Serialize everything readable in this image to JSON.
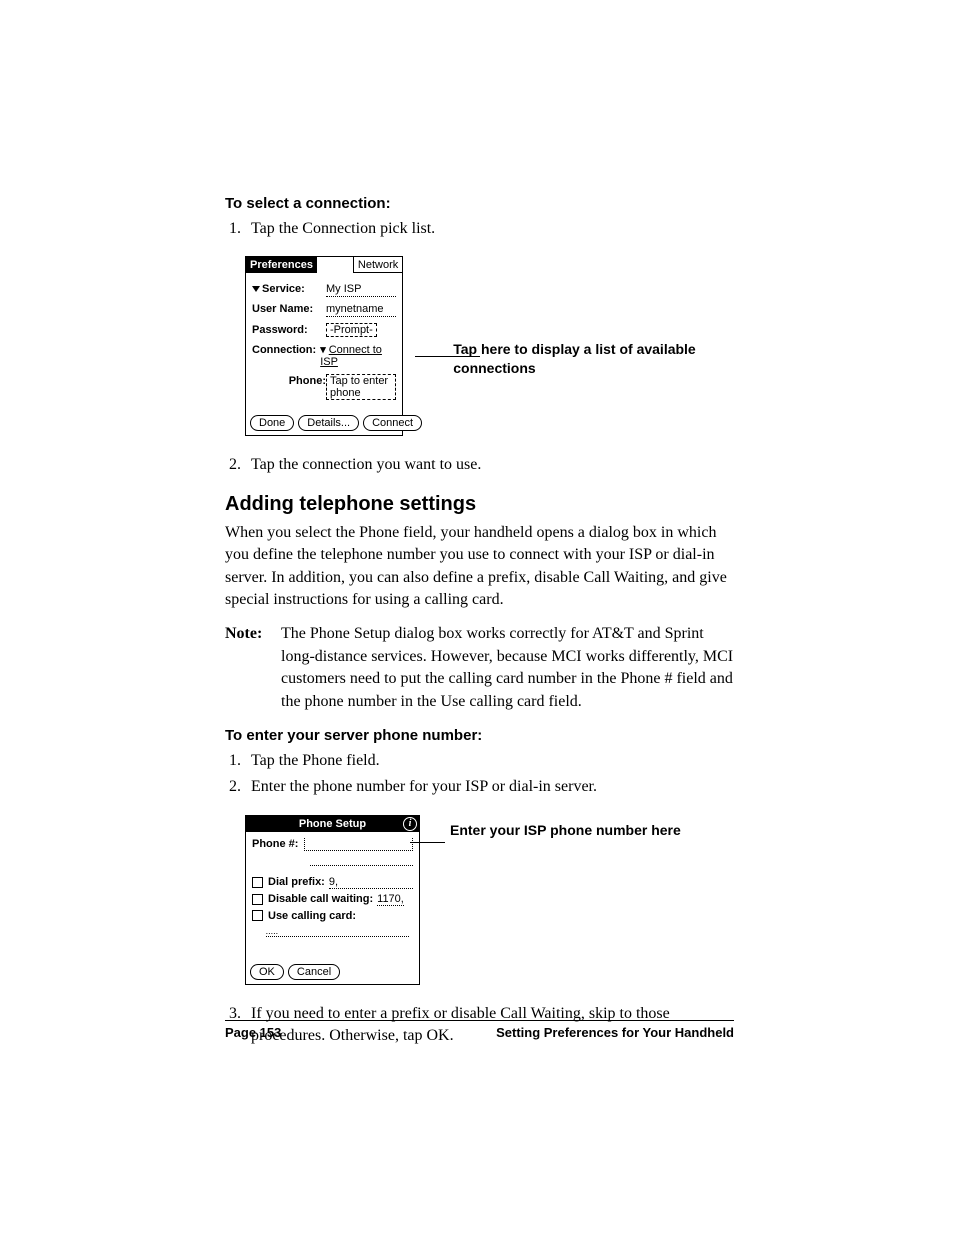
{
  "headings": {
    "select_connection": "To select a connection:",
    "adding_telephone": "Adding telephone settings",
    "enter_server_phone": "To enter your server phone number:"
  },
  "steps_a": {
    "s1": "Tap the Connection pick list.",
    "s2": "Tap the connection you want to use."
  },
  "body": {
    "para1": "When you select the Phone field, your handheld opens a dialog box in which you define the telephone number you use to connect with your ISP or dial-in server. In addition, you can also define a prefix, disable Call Waiting, and give special instructions for using a calling card.",
    "note_label": "Note:",
    "note_text": "The Phone Setup dialog box works correctly for AT&T and Sprint long-distance services. However, because MCI works differently, MCI customers need to put the calling card number in the Phone # field and the phone number in the Use calling card field."
  },
  "steps_b": {
    "s1": "Tap the Phone field.",
    "s2": "Enter the phone number for your ISP or dial-in server.",
    "s3": "If you need to enter a prefix or disable Call Waiting, skip to those procedures. Otherwise, tap OK."
  },
  "prefs_shot": {
    "title_left": "Preferences",
    "title_right": "Network",
    "service_label": "Service:",
    "service_value": "My ISP",
    "username_label": "User Name:",
    "username_value": "mynetname",
    "password_label": "Password:",
    "password_value": "-Prompt-",
    "connection_label": "Connection:",
    "connection_value": "Connect to ISP",
    "phone_label": "Phone:",
    "phone_value": "Tap to enter phone",
    "btn_done": "Done",
    "btn_details": "Details...",
    "btn_connect": "Connect"
  },
  "callout1": "Tap here to display a list of available connections",
  "phone_shot": {
    "title": "Phone Setup",
    "phone_num_label": "Phone #:",
    "dial_prefix_label": "Dial prefix:",
    "dial_prefix_value": "9,",
    "disable_cw_label": "Disable call waiting:",
    "disable_cw_value": "1170,",
    "use_cc_label": "Use calling card:",
    "btn_ok": "OK",
    "btn_cancel": "Cancel"
  },
  "callout2": "Enter your ISP phone number here",
  "footer": {
    "page": "Page 153",
    "chapter": "Setting Preferences for Your Handheld"
  }
}
